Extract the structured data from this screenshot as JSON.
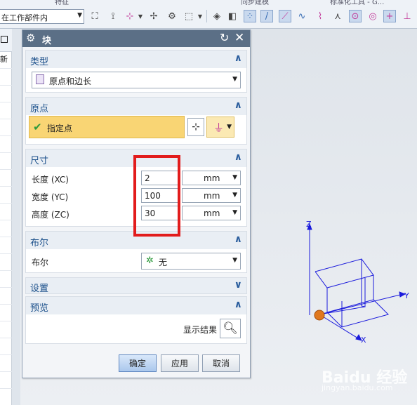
{
  "toolbar": {
    "ribbon_labels": [
      "特征",
      "同步建模",
      "标准化工具 - G..."
    ],
    "scope_value": "在工作部件内",
    "colors": {
      "highlight": "#e21c1c",
      "title_bar": "#5b6f86",
      "section_title": "#1a4f8a",
      "specify_point_bg": "#f9d574"
    }
  },
  "left_strip": {
    "label": "新"
  },
  "dialog": {
    "title": "块",
    "sections": {
      "type": {
        "title": "类型",
        "value": "原点和边长"
      },
      "origin": {
        "title": "原点",
        "specify_point": "指定点"
      },
      "dimensions": {
        "title": "尺寸",
        "rows": [
          {
            "label": "长度 (XC)",
            "value": "2",
            "unit": "mm"
          },
          {
            "label": "宽度 (YC)",
            "value": "100",
            "unit": "mm"
          },
          {
            "label": "高度 (ZC)",
            "value": "30",
            "unit": "mm"
          }
        ]
      },
      "boolean": {
        "title": "布尔",
        "label": "布尔",
        "value": "无"
      },
      "settings": {
        "title": "设置"
      },
      "preview": {
        "title": "预览",
        "show_result": "显示结果"
      }
    },
    "buttons": {
      "ok": "确定",
      "apply": "应用",
      "cancel": "取消"
    }
  },
  "canvas": {
    "axes": {
      "x": "X",
      "y": "Y",
      "z": "Z"
    }
  },
  "watermark": {
    "text": "Baidu 经验",
    "sub": "jingyan.baidu.com"
  }
}
